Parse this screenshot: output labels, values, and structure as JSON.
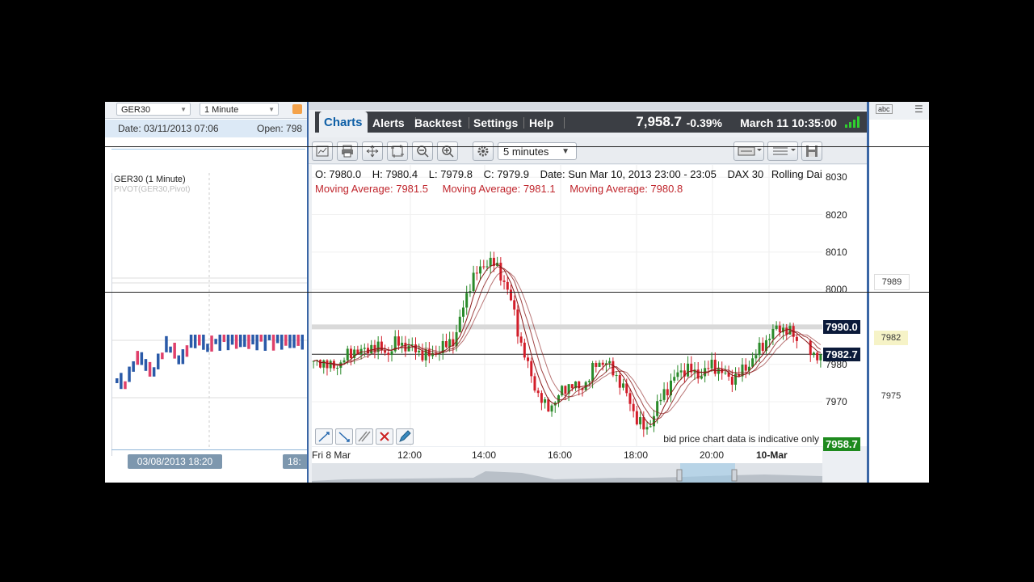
{
  "left_panel": {
    "symbol_select": "GER30",
    "interval_select": "1 Minute",
    "info_date": "Date: 03/11/2013 07:06",
    "info_open": "Open: 798",
    "chart_title": "GER30",
    "chart_interval": "(1 Minute)",
    "chart_indicator": "PIVOT(GER30,Pivot)",
    "date_label": "03/08/2013  18:20",
    "date_label2": "18:"
  },
  "menubar": {
    "items": [
      "Charts",
      "Alerts",
      "Backtest",
      "Settings",
      "Help"
    ],
    "price": "7,958.7",
    "change": "-0.39%",
    "datetime": "March 11 10:35:00"
  },
  "toolbar": {
    "interval": "5 minutes",
    "icons": [
      "chart-type-icon",
      "print-icon",
      "pan-icon",
      "zoom-box-icon",
      "zoom-out-icon",
      "zoom-in-icon",
      "gear-icon",
      "layout-icon",
      "list-icon",
      "save-icon"
    ]
  },
  "header": {
    "open": "O: 7980.0",
    "high": "H: 7980.4",
    "low": "L: 7979.8",
    "close": "C: 7979.9",
    "date": "Date: Sun Mar 10, 2013 23:00 - 23:05",
    "instrument": "DAX 30",
    "contract": "Rolling Daily",
    "ma1": "Moving Average: 7981.5",
    "ma2": "Moving Average: 7981.1",
    "ma3": "Moving Average: 7980.8"
  },
  "disclaimer": "bid price chart data is indicative only",
  "chart_data": {
    "type": "candlestick",
    "y_ticks": [
      8030,
      8020,
      8010,
      8000,
      7990,
      7980,
      7970
    ],
    "x_ticks": [
      "Fri 8 Mar",
      "12:00",
      "14:00",
      "16:00",
      "18:00",
      "20:00",
      "10-Mar"
    ],
    "ylim": [
      7962,
      8032
    ],
    "price_tags": [
      {
        "value": "7990.0",
        "color": "#0b1a3a"
      },
      {
        "value": "7982.7",
        "color": "#0b1a3a"
      },
      {
        "value": "7958.7",
        "color": "#1e8a1e"
      }
    ],
    "close_path": [
      7980,
      7981,
      7979,
      7980,
      7982,
      7984,
      7983,
      7985,
      7984,
      7983,
      7986,
      7985,
      7984,
      7983,
      7982,
      7984,
      7985,
      7987,
      7995,
      8003,
      8005,
      8008,
      8006,
      8002,
      7995,
      7985,
      7978,
      7972,
      7968,
      7970,
      7973,
      7975,
      7973,
      7976,
      7980,
      7981,
      7978,
      7975,
      7970,
      7965,
      7962,
      7967,
      7972,
      7975,
      7978,
      7979,
      7977,
      7978,
      7980,
      7978,
      7976,
      7977,
      7979,
      7982,
      7985,
      7988,
      7990,
      7989,
      7987,
      7985,
      7983,
      7982
    ],
    "moving_averages": [
      "7981.5",
      "7981.1",
      "7980.8"
    ],
    "colors": {
      "up": "#2a8a2a",
      "down": "#d21e2a",
      "ma": "#8b1a1a"
    }
  },
  "right_panel": {
    "tag1": "7989",
    "tag2": "7982",
    "tag3": "7975",
    "top_icon": "abc"
  }
}
